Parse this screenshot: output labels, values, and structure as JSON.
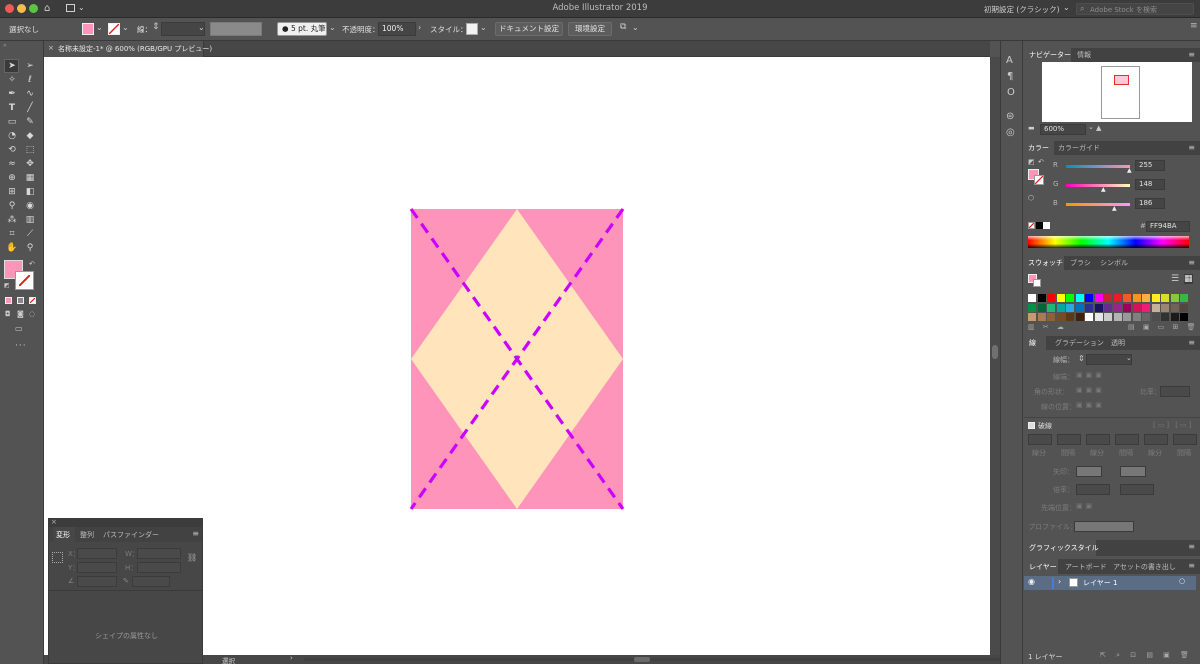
{
  "app": {
    "title": "Adobe Illustrator 2019",
    "workspace": "初期設定 (クラシック)",
    "stock_search_placeholder": "Adobe Stock を検索"
  },
  "control_bar": {
    "selection_label": "選択なし",
    "stroke_label": "線：",
    "brush_label": "5 pt. 丸筆",
    "opacity_label": "不透明度：",
    "opacity_value": "100%",
    "style_label": "スタイル：",
    "doc_settings": "ドキュメント設定",
    "preferences": "環境設定",
    "fill_color": "#FF94BA"
  },
  "document_tab": {
    "title": "名称未設定-1* @ 600% (RGB/GPU プレビュー)",
    "close": "×"
  },
  "artwork": {
    "background_color": "#FF94BA",
    "diamond_color": "#FFE4BC",
    "stroke_color": "#CC00FF"
  },
  "navigator": {
    "tab_navigator": "ナビゲーター",
    "tab_info": "情報",
    "zoom": "600%"
  },
  "color_panel": {
    "tab_color": "カラー",
    "tab_guide": "カラーガイド",
    "r_label": "R",
    "g_label": "G",
    "b_label": "B",
    "r_value": "255",
    "g_value": "148",
    "b_value": "186",
    "hex_label": "#",
    "hex_value": "FF94BA"
  },
  "swatches_panel": {
    "tab_swatches": "スウォッチ",
    "tab_brush": "ブラシ",
    "tab_symbol": "シンボル"
  },
  "stroke_panel": {
    "tab_stroke": "線",
    "tab_gradient": "グラデーション",
    "tab_transparency": "透明",
    "weight_label": "線幅：",
    "cap_label": "線端：",
    "corner_label": "角の形状：",
    "ratio_label": "比率：",
    "align_label": "線の位置：",
    "dashed_label": "破線",
    "dash_labels": [
      "線分",
      "間隔",
      "線分",
      "間隔",
      "線分",
      "間隔"
    ],
    "arrow_label": "矢印：",
    "scale_label": "倍率：",
    "tip_label": "先端位置：",
    "profile_label": "プロファイル："
  },
  "graphic_styles": {
    "title": "グラフィックスタイル"
  },
  "layers_panel": {
    "tab_layers": "レイヤー",
    "tab_artboards": "アートボード",
    "tab_asset": "アセットの書き出し",
    "layer_name": "レイヤー 1",
    "footer_count": "1 レイヤー"
  },
  "transform_panel": {
    "tab_transform": "変形",
    "tab_align": "整列",
    "tab_pathfinder": "パスファインダー",
    "x_label": "X：",
    "y_label": "Y：",
    "w_label": "W：",
    "h_label": "H：",
    "no_attributes": "シェイプの属性なし"
  },
  "status_bar": {
    "tool": "選択"
  }
}
